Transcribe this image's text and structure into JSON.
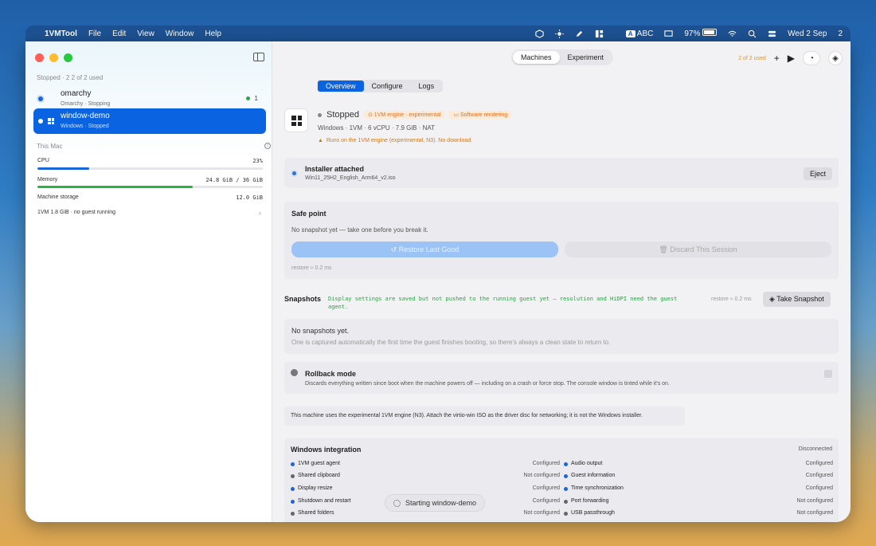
{
  "menubar": {
    "app_name": "1VMTool",
    "menus": [
      "File",
      "Edit",
      "View",
      "Window",
      "Help"
    ],
    "input_source": "A",
    "input_label": "ABC",
    "battery": "97%",
    "datetime": "Wed 2 Sep",
    "trailing": "2"
  },
  "sidebar": {
    "header": "Stopped · 2    2 of 2 used",
    "machines": [
      {
        "name": "omarchy",
        "sub": "Omarchy · Stopping",
        "count": "1"
      },
      {
        "name": "window-demo",
        "sub": "Windows · Stopped"
      }
    ],
    "this_mac": "This Mac",
    "cpu_label": "CPU",
    "cpu_value": "23%",
    "cpu_fraction": 0.23,
    "memory_label": "Memory",
    "memory_value": "24.8 GiB / 36 GiB",
    "memory_fraction": 0.69,
    "storage_label": "Machine storage",
    "storage_value": "12.0 GiB",
    "footer": "1VM 1.8 GiB · no guest running"
  },
  "toolbar": {
    "seg": [
      "Machines",
      "Experiment"
    ],
    "used": "2 of 2 used"
  },
  "tabs": [
    "Overview",
    "Configure",
    "Logs"
  ],
  "vm": {
    "status": "Stopped",
    "badge1": "1VM engine · experimental",
    "badge2": "Software rendering",
    "spec": "Windows · 1VM · 6 vCPU · 7.9 GiB · NAT",
    "warning": "Runs on the 1VM engine (experimental, N3). No download."
  },
  "installer": {
    "title": "Installer attached",
    "file": "Win11_25H2_English_Arm64_v2.iso",
    "eject": "Eject"
  },
  "safe_point": {
    "title": "Safe point",
    "desc": "No snapshot yet — take one before you break it.",
    "restore": "Restore Last Good",
    "discard": "Discard This Session",
    "note": "restore ≈ 0.2 ms"
  },
  "snapshots": {
    "title": "Snapshots",
    "note": "Display settings are saved but not pushed to the running guest yet — resolution and HiDPI need the guest agent.",
    "restore": "restore ≈ 0.2 ms",
    "button": "Take Snapshot",
    "empty_title": "No snapshots yet.",
    "empty_desc": "One is captured automatically the first time the guest finishes booting, so there's always a clean state to return to."
  },
  "rollback": {
    "title": "Rollback mode",
    "desc": "Discards everything written since boot when the machine powers off — including on a crash or force stop. The console window is tinted while it's on."
  },
  "engine_note": "This machine uses the experimental 1VM engine (N3). Attach the virtio-win ISO as the driver disc for networking; it is not the Windows installer.",
  "integration": {
    "title": "Windows integration",
    "status": "Disconnected",
    "left": [
      {
        "label": "1VM guest agent",
        "value": "Configured",
        "color": "blue"
      },
      {
        "label": "Shared clipboard",
        "value": "Not configured",
        "color": "gray"
      },
      {
        "label": "Display resize",
        "value": "Configured",
        "color": "blue"
      },
      {
        "label": "Shutdown and restart",
        "value": "Configured",
        "color": "blue"
      },
      {
        "label": "Shared folders",
        "value": "Not configured",
        "color": "gray"
      }
    ],
    "right": [
      {
        "label": "Audio output",
        "value": "Configured",
        "color": "blue"
      },
      {
        "label": "Guest information",
        "value": "Configured",
        "color": "blue"
      },
      {
        "label": "Time synchronization",
        "value": "Configured",
        "color": "blue"
      },
      {
        "label": "Port forwarding",
        "value": "Not configured",
        "color": "gray"
      },
      {
        "label": "USB passthrough",
        "value": "Not configured",
        "color": "gray"
      }
    ]
  },
  "toast": "Starting window-demo",
  "colors": {
    "accent": "#0a63e0",
    "memory_bar": "#28b445",
    "warning": "#d07a1a"
  }
}
